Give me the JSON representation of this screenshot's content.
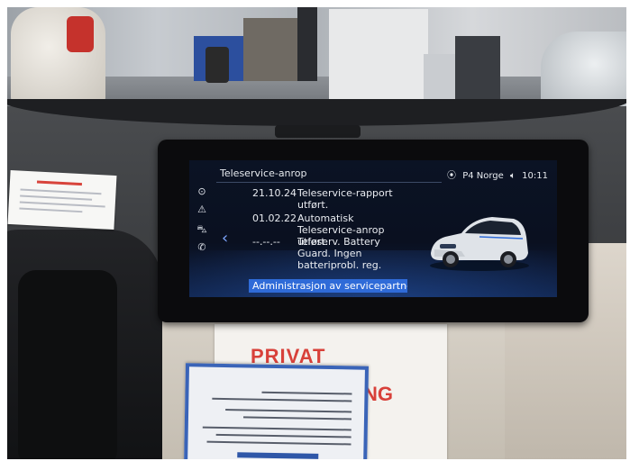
{
  "screen": {
    "title": "Teleservice-anrop",
    "status": {
      "station": "P4 Norge",
      "time": "10:11"
    },
    "rows": [
      {
        "date": "21.10.24",
        "text": "Teleservice-rapport utført."
      },
      {
        "date": "01.02.22",
        "text": "Automatisk Teleservice-anrop utført."
      },
      {
        "date": "--.--.--",
        "text": "Teleserv. Battery Guard. Ingen batteriprobl. reg."
      }
    ],
    "highlight": "Administrasjon av servicepartne"
  },
  "sign": {
    "line1": "PRIVAT",
    "line2": "NG"
  },
  "colors": {
    "highlight": "#2f6bd8",
    "screen_bg": "#0b1324",
    "sign_red": "#d8413a"
  }
}
